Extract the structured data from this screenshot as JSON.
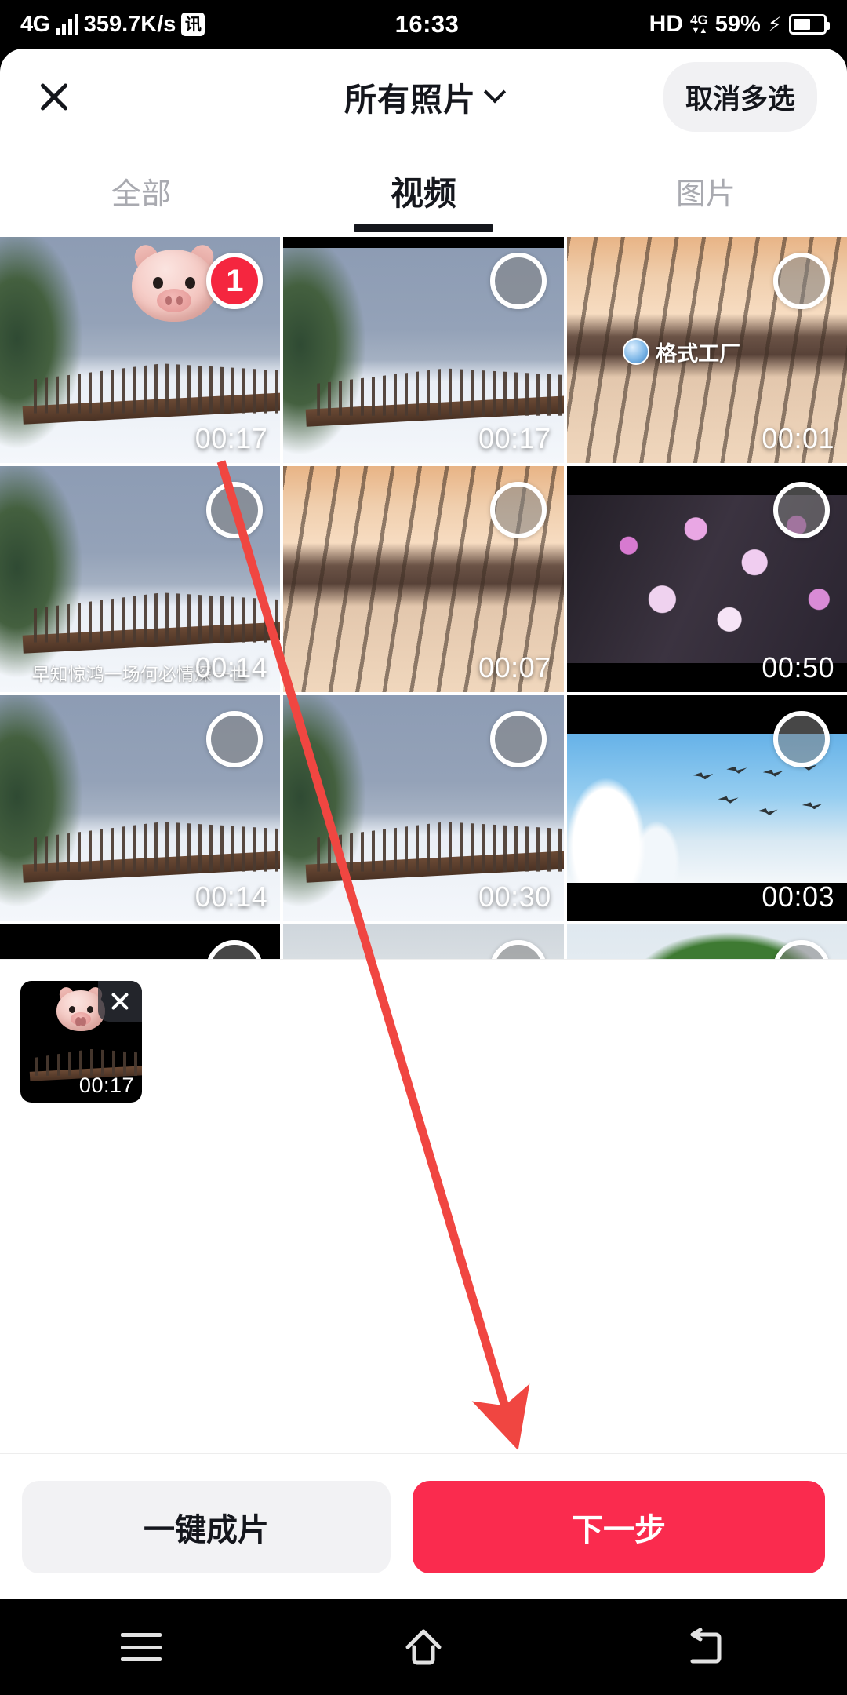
{
  "status_bar": {
    "network_type": "4G",
    "speed": "359.7K/s",
    "ime_badge": "讯",
    "clock": "16:33",
    "hd": "HD",
    "volte": "4G",
    "battery_pct": "59%",
    "charging_icon": "bolt-icon"
  },
  "header": {
    "close_icon": "close-icon",
    "title": "所有照片",
    "chevron_icon": "chevron-down-icon",
    "cancel_multi_label": "取消多选"
  },
  "tabs": [
    {
      "label": "全部",
      "active": false
    },
    {
      "label": "视频",
      "active": true
    },
    {
      "label": "图片",
      "active": false
    }
  ],
  "grid": {
    "items": [
      {
        "duration": "00:17",
        "selected": true,
        "badge": "1",
        "scene": "fence",
        "overlay_emoji": "pig-emoji"
      },
      {
        "duration": "00:17",
        "selected": false,
        "badge": "",
        "scene": "fence",
        "overlay_emoji": ""
      },
      {
        "duration": "00:01",
        "selected": false,
        "badge": "",
        "scene": "sunset",
        "watermark": "格式工厂"
      },
      {
        "duration": "00:14",
        "selected": false,
        "badge": "",
        "scene": "fence",
        "caption": "早知惊鸿一场何必情深一世"
      },
      {
        "duration": "00:07",
        "selected": false,
        "badge": "",
        "scene": "sunset",
        "overlay_emoji": ""
      },
      {
        "duration": "00:50",
        "selected": false,
        "badge": "",
        "scene": "blossom",
        "overlay_emoji": ""
      },
      {
        "duration": "00:14",
        "selected": false,
        "badge": "",
        "scene": "fence",
        "overlay_emoji": ""
      },
      {
        "duration": "00:30",
        "selected": false,
        "badge": "",
        "scene": "fence",
        "overlay_emoji": ""
      },
      {
        "duration": "00:03",
        "selected": false,
        "badge": "",
        "scene": "birds",
        "overlay_emoji": ""
      },
      {
        "duration": "",
        "selected": false,
        "badge": "",
        "scene": "collage",
        "overlay_emoji": ""
      },
      {
        "duration": "",
        "selected": false,
        "badge": "",
        "scene": "misty",
        "overlay_emoji": ""
      },
      {
        "duration": "",
        "selected": false,
        "badge": "",
        "scene": "leaf",
        "overlay_emoji": ""
      }
    ]
  },
  "selected_strip": {
    "items": [
      {
        "duration": "00:17",
        "remove_icon": "close-icon",
        "overlay_emoji": "pig-emoji"
      }
    ]
  },
  "actions": {
    "secondary_label": "一键成片",
    "primary_label": "下一步"
  },
  "nav_bar": {
    "menu_icon": "menu-icon",
    "home_icon": "home-icon",
    "back_icon": "back-icon"
  },
  "annotation": {
    "arrow_color": "#f04641",
    "arrow_icon": "arrow-pointer-icon"
  },
  "colors": {
    "accent_red": "#fa2b4e",
    "badge_red": "#f5263f",
    "annotation_red": "#f04641",
    "text_primary": "#14161c",
    "text_muted": "#a9aab0",
    "chip_grey": "#f2f2f4"
  }
}
